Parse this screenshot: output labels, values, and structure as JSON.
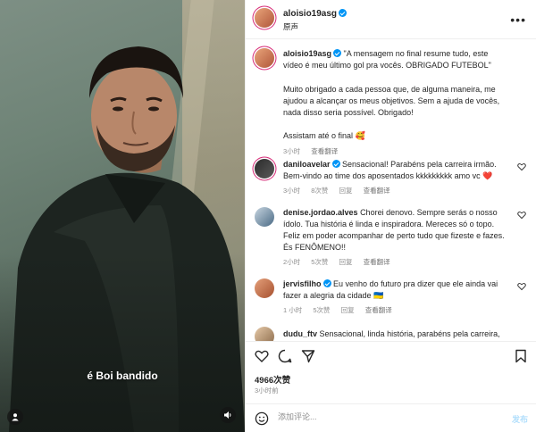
{
  "video": {
    "caption": "é Boi bandido"
  },
  "header": {
    "username": "aloisio19asg",
    "audio": "原声"
  },
  "post": {
    "username": "aloisio19asg",
    "text": "\"A mensagem no final resume tudo, este vídeo é meu último gol pra vocês. OBRIGADO FUTEBOL\"",
    "paragraph2": "Muito obrigado a cada pessoa que, de alguma maneira, me ajudou a alcançar os meus objetivos. Sem a ajuda de vocês, nada disso seria possível. Obrigado!",
    "paragraph3": "Assistam até o final 🥰",
    "time": "3小时",
    "translate": "查看翻译"
  },
  "comments": [
    {
      "username": "daniloavelar",
      "text": "Sensacional! Parabéns pela carreira irmão. Bem-vindo ao time dos aposentados kkkkkkkkk amo vc ❤️",
      "time": "3小时",
      "likes": "8次赞",
      "reply": "回复",
      "translate": "查看翻译"
    },
    {
      "username": "denise.jordao.alves",
      "text": "Chorei denovo. Sempre serás o nosso ídolo. Tua história é linda e inspiradora. Mereces só o topo. Feliz em poder acompanhar de perto tudo que fizeste e fazes. És FENÔMENO!!",
      "time": "2小时",
      "likes": "5次赞",
      "reply": "回复",
      "translate": "查看翻译"
    },
    {
      "username": "jervisfilho",
      "text": "Eu venho do futuro pra dizer que ele ainda vai fazer a alegria da cidade 🇺🇦",
      "time": "1 小时",
      "likes": "5次赞",
      "reply": "回复",
      "translate": "查看翻译"
    },
    {
      "username": "dudu_ftv",
      "text": "Sensacional, linda história, parabéns pela carreira,"
    }
  ],
  "stats": {
    "likes": "4966次赞",
    "time": "3小时前"
  },
  "compose": {
    "placeholder": "添加评论...",
    "post_label": "发布"
  },
  "icons": {
    "verified": "verified-badge-icon",
    "more": "more-options-icon",
    "like": "heart-icon",
    "comment": "comment-icon",
    "share": "share-icon",
    "save": "bookmark-icon",
    "emoji": "emoji-icon",
    "sound": "speaker-icon",
    "user": "user-icon"
  },
  "colors": {
    "verified": "#0095f6",
    "text": "#262626",
    "muted": "#8e8e8e",
    "post_disabled": "#b2dffc",
    "heart_red": "#ed4956"
  }
}
